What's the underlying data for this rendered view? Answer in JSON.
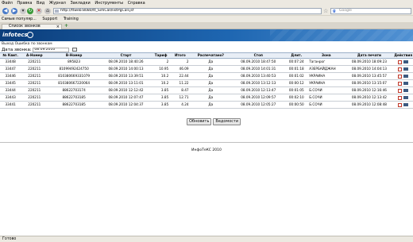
{
  "browser": {
    "menu": [
      "Файл",
      "Правка",
      "Вид",
      "Журнал",
      "Закладки",
      "Инструменты",
      "Справка"
    ],
    "address": "http://ttweb:8080/tt_SimCall/listPgCall.jsf",
    "search_placeholder": "Google",
    "bookmarks": [
      "Самые популяр...",
      "Support",
      "Training"
    ],
    "tab_title": "Список звонков",
    "status": "Готово"
  },
  "header": {
    "logo": "infotecs"
  },
  "page": {
    "exit_link": "Выход",
    "report_link": "Ошибка по звонкам",
    "filter_label": "Дата звонка:",
    "filter_value": "08.09.2010"
  },
  "table": {
    "columns": [
      "№ Квит.",
      "А-Номер",
      "B-Номер",
      "Старт",
      "Тариф",
      "Итого",
      "Распечатано?",
      "Стоп",
      "Длит.",
      "Зона",
      "Дата печати",
      "Действия"
    ],
    "rows": [
      [
        "33448",
        "220211",
        "895823",
        "08.09.2010 18:40:26",
        "2",
        "2",
        "Да",
        "08.09.2010 18:47:50",
        "00:07:24",
        "Таганрог",
        "08.09.2010 18:09:23"
      ],
      [
        "33447",
        "220211",
        "81099492424750",
        "08.09.2010 14:00:13",
        "10.95",
        "46.09",
        "Да",
        "08.09.2010 14:01:31",
        "00:01:18",
        "АЗЕРБАЙДЖАН",
        "08.09.2010 14:04:13"
      ],
      [
        "33446",
        "220211",
        "810380669331079",
        "08.09.2010 13:39:51",
        "10.2",
        "22.44",
        "Да",
        "08.09.2010 13:40:53",
        "00:01:02",
        "УКРАИНА",
        "08.09.2010 13:45:57"
      ],
      [
        "33445",
        "220211",
        "810380667220064",
        "08.09.2010 13:11:01",
        "10.2",
        "11.22",
        "Да",
        "08.09.2010 13:12:13",
        "00:00:12",
        "УКРАИНА",
        "08.09.2010 13:15:07"
      ],
      [
        "33444",
        "220211",
        "88622703174",
        "08.09.2010 12:12:42",
        "3.85",
        "8.47",
        "Да",
        "08.09.2010 12:13:47",
        "00:01:05",
        "Б.СОЧИ",
        "08.09.2010 12:16:46"
      ],
      [
        "33443",
        "220211",
        "88622703185",
        "08.09.2010 12:07:47",
        "3.85",
        "12.71",
        "Да",
        "08.09.2010 12:09:57",
        "00:02:10",
        "Б.СОЧИ",
        "08.09.2010 12:13:42"
      ],
      [
        "33441",
        "220211",
        "88622703185",
        "08.09.2010 12:04:37",
        "3.85",
        "4.24",
        "Да",
        "08.09.2010 12:05:27",
        "00:00:50",
        "Б.СОЧИ",
        "08.09.2010 12:08:48"
      ]
    ]
  },
  "actions": {
    "refresh": "Обновить",
    "report": "Ведомости"
  },
  "footer": {
    "copyright": "ИнфоТеКС 2010"
  }
}
